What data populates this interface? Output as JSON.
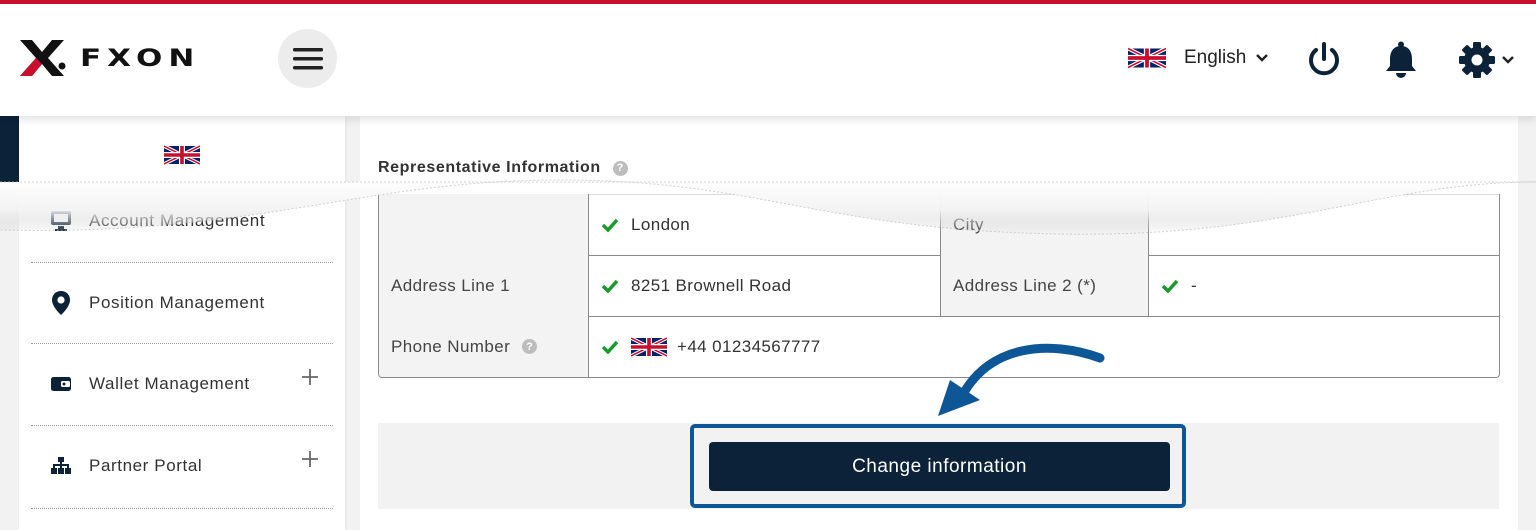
{
  "header": {
    "brand": "FXON",
    "language": "English",
    "icons": {
      "menu": "hamburger-menu-icon",
      "flag": "uk-flag-icon",
      "chevron": "chevron-down-icon",
      "power": "power-icon",
      "bell": "bell-icon",
      "settings": "gear-icon"
    }
  },
  "sidebar": {
    "items": [
      {
        "label": "Account Management",
        "icon": "monitor-icon",
        "expandable": false
      },
      {
        "label": "Position Management",
        "icon": "location-pin-icon",
        "expandable": false
      },
      {
        "label": "Wallet Management",
        "icon": "wallet-icon",
        "expandable": true
      },
      {
        "label": "Partner Portal",
        "icon": "sitemap-icon",
        "expandable": true
      }
    ]
  },
  "main": {
    "section_title": "Representative Information",
    "table": {
      "rows": [
        {
          "label1": "",
          "value1": "London",
          "label2": "City",
          "value2": ""
        },
        {
          "label1": "Address Line 1",
          "value1": "8251 Brownell Road",
          "label2": "Address Line 2 (*)",
          "value2": "-"
        },
        {
          "label1": "Phone Number",
          "value1": "+44 01234567777"
        }
      ]
    },
    "button_label": "Change information"
  },
  "colors": {
    "accent_red": "#c8102e",
    "navy": "#0b2239",
    "highlight_blue": "#0e5796",
    "check_green": "#1a9a2a"
  }
}
